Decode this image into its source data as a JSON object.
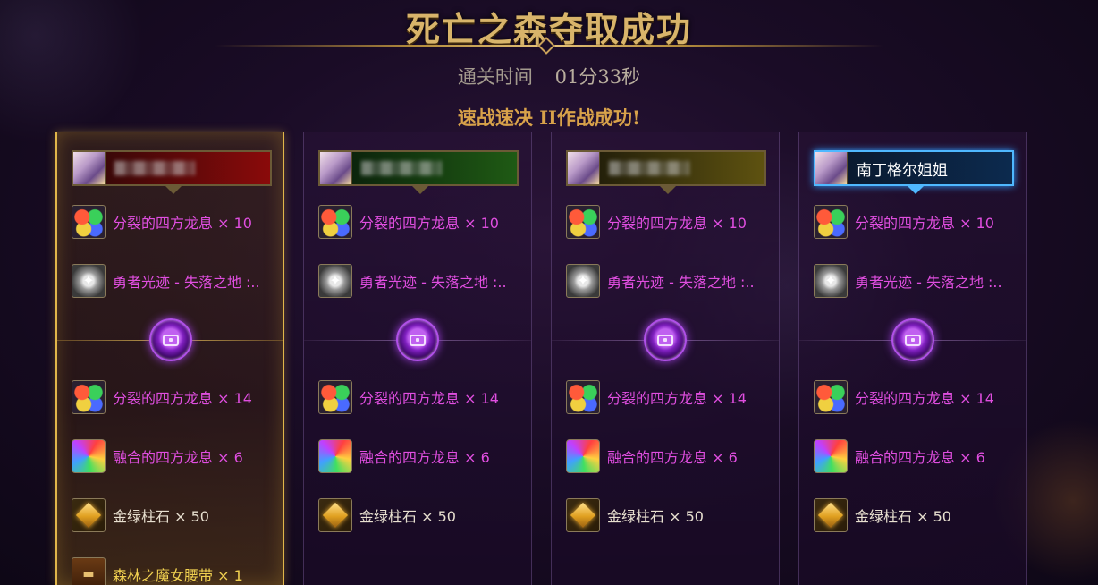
{
  "header": {
    "title": "死亡之森夺取成功",
    "clear_time_label": "通关时间",
    "clear_time_value": "01分33秒",
    "mission_text": "速战速决 II作战成功!"
  },
  "players": [
    {
      "name": "",
      "name_blurred": true,
      "bar_color": "red",
      "selected": true,
      "rewards_top": [
        {
          "icon": "dragon-breath-icon",
          "text": "分裂的四方龙息 × 10",
          "color": "pink"
        },
        {
          "icon": "hero-trace-icon",
          "text": "勇者光迹 - 失落之地 :..",
          "color": "pink"
        }
      ],
      "rewards_bottom": [
        {
          "icon": "dragon-breath-icon",
          "text": "分裂的四方龙息 × 14",
          "color": "pink"
        },
        {
          "icon": "fused-breath-icon",
          "text": "融合的四方龙息 × 6",
          "color": "pink"
        },
        {
          "icon": "gold-green-stone-icon",
          "text": "金绿柱石 × 50",
          "color": "white"
        },
        {
          "icon": "witch-belt-icon",
          "text": "森林之魔女腰带 × 1",
          "color": "gold"
        }
      ]
    },
    {
      "name": "",
      "name_blurred": true,
      "bar_color": "green",
      "selected": false,
      "rewards_top": [
        {
          "icon": "dragon-breath-icon",
          "text": "分裂的四方龙息 × 10",
          "color": "pink"
        },
        {
          "icon": "hero-trace-icon",
          "text": "勇者光迹 - 失落之地 :..",
          "color": "pink"
        }
      ],
      "rewards_bottom": [
        {
          "icon": "dragon-breath-icon",
          "text": "分裂的四方龙息 × 14",
          "color": "pink"
        },
        {
          "icon": "fused-breath-icon",
          "text": "融合的四方龙息 × 6",
          "color": "pink"
        },
        {
          "icon": "gold-green-stone-icon",
          "text": "金绿柱石 × 50",
          "color": "white"
        }
      ]
    },
    {
      "name": "",
      "name_blurred": true,
      "bar_color": "olive",
      "selected": false,
      "rewards_top": [
        {
          "icon": "dragon-breath-icon",
          "text": "分裂的四方龙息 × 10",
          "color": "pink"
        },
        {
          "icon": "hero-trace-icon",
          "text": "勇者光迹 - 失落之地 :..",
          "color": "pink"
        }
      ],
      "rewards_bottom": [
        {
          "icon": "dragon-breath-icon",
          "text": "分裂的四方龙息 × 14",
          "color": "pink"
        },
        {
          "icon": "fused-breath-icon",
          "text": "融合的四方龙息 × 6",
          "color": "pink"
        },
        {
          "icon": "gold-green-stone-icon",
          "text": "金绿柱石 × 50",
          "color": "white"
        }
      ]
    },
    {
      "name": "南丁格尔姐姐",
      "name_blurred": false,
      "bar_color": "blue",
      "selected": false,
      "rewards_top": [
        {
          "icon": "dragon-breath-icon",
          "text": "分裂的四方龙息 × 10",
          "color": "pink"
        },
        {
          "icon": "hero-trace-icon",
          "text": "勇者光迹 - 失落之地 :..",
          "color": "pink"
        }
      ],
      "rewards_bottom": [
        {
          "icon": "dragon-breath-icon",
          "text": "分裂的四方龙息 × 14",
          "color": "pink"
        },
        {
          "icon": "fused-breath-icon",
          "text": "融合的四方龙息 × 6",
          "color": "pink"
        },
        {
          "icon": "gold-green-stone-icon",
          "text": "金绿柱石 × 50",
          "color": "white"
        }
      ]
    }
  ],
  "colors": {
    "title": "#d8b46a",
    "mission": "#d8a24a",
    "epic_item": "#e04ee0",
    "legendary_item": "#f0d050",
    "selected_border": "#e0b64a",
    "own_namebar": "#4fb8ff"
  }
}
